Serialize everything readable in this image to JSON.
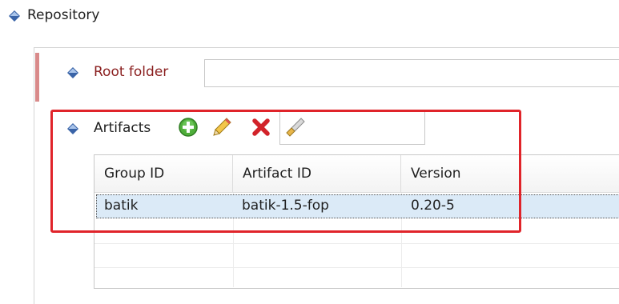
{
  "repository": {
    "title": "Repository"
  },
  "root_folder": {
    "label": "Root folder",
    "value": ""
  },
  "artifacts": {
    "label": "Artifacts",
    "toolbar": [
      "add-icon",
      "edit-icon",
      "delete-icon",
      "browse-icon"
    ],
    "filter_value": ""
  },
  "table": {
    "columns": [
      "Group ID",
      "Artifact ID",
      "Version"
    ],
    "rows": [
      {
        "group_id": "batik",
        "artifact_id": "batik-1.5-fop",
        "version": "0.20-5"
      }
    ]
  },
  "colors": {
    "required_label": "#8a1f1f",
    "highlight": "#e0242a",
    "selection": "#dbeaf7"
  }
}
